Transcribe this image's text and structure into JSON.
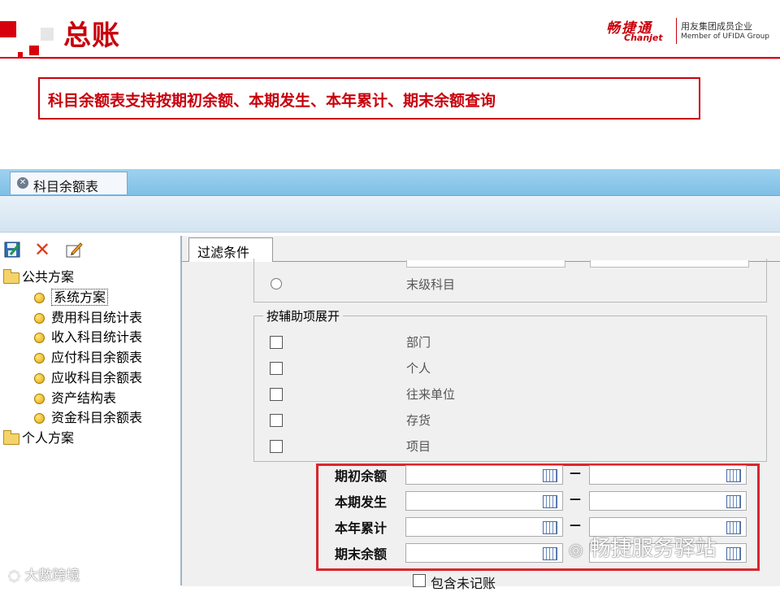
{
  "slide": {
    "title": "总账",
    "callout": "科目余额表支持按期初余额、本期发生、本年累计、期末余额查询"
  },
  "logo": {
    "name_cn": "畅捷通",
    "name_en": "Chanjet",
    "member_cn": "用友集团成员企业",
    "member_en": "Member of UFIDA Group"
  },
  "colors": {
    "brand_red": "#c8000c",
    "highlight_box": "#d9262e",
    "tab_blue": "#8ecaec"
  },
  "window": {
    "doc_tab": "科目余额表",
    "close_icon": "close-circle-icon"
  },
  "left_panel": {
    "toolbar_icons": [
      "save-icon",
      "delete-icon",
      "edit-icon"
    ],
    "public_folder": "公共方案",
    "public_items": [
      "系统方案",
      "费用科目统计表",
      "收入科目统计表",
      "应付科目余额表",
      "应收科目余额表",
      "资产结构表",
      "资金科目余额表"
    ],
    "selected_index": 0,
    "personal_folder": "个人方案"
  },
  "filter": {
    "tab": "过滤条件",
    "radio_last_level": "末级科目",
    "aux_group_title": "按辅助项展开",
    "aux_options": [
      "部门",
      "个人",
      "往来单位",
      "存货",
      "项目"
    ],
    "amount_rows": [
      {
        "label": "期初余额",
        "from": "",
        "to": ""
      },
      {
        "label": "本期发生",
        "from": "",
        "to": ""
      },
      {
        "label": "本年累计",
        "from": "",
        "to": ""
      },
      {
        "label": "期末余额",
        "from": "",
        "to": ""
      }
    ],
    "range_separator": "—",
    "include_unposted": "包含未记账"
  },
  "watermarks": {
    "right": "畅捷服务驿站",
    "left": "大數跨境"
  }
}
